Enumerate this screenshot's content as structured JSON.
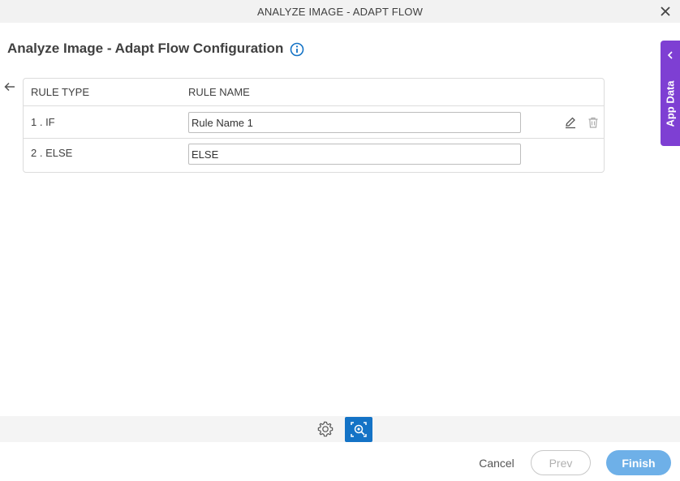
{
  "window": {
    "title": "ANALYZE IMAGE - ADAPT FLOW"
  },
  "page": {
    "title": "Analyze Image - Adapt Flow Configuration"
  },
  "table": {
    "headers": {
      "rule_type": "RULE TYPE",
      "rule_name": "RULE NAME"
    },
    "rows": [
      {
        "type": "1 . IF",
        "name": "Rule Name 1"
      },
      {
        "type": "2 . ELSE",
        "name": "ELSE"
      }
    ]
  },
  "side_panel": {
    "label": "App Data"
  },
  "footer": {
    "cancel_label": "Cancel",
    "prev_label": "Prev",
    "finish_label": "Finish"
  },
  "colors": {
    "accent_purple": "#7e3fd3",
    "primary_blue": "#1473c6",
    "finish_blue": "#6eb0e8"
  },
  "icons": [
    "close-icon",
    "info-icon",
    "back-arrow-icon",
    "edit-icon",
    "delete-icon",
    "chevron-left-icon",
    "settings-icon",
    "analyze-image-icon"
  ]
}
